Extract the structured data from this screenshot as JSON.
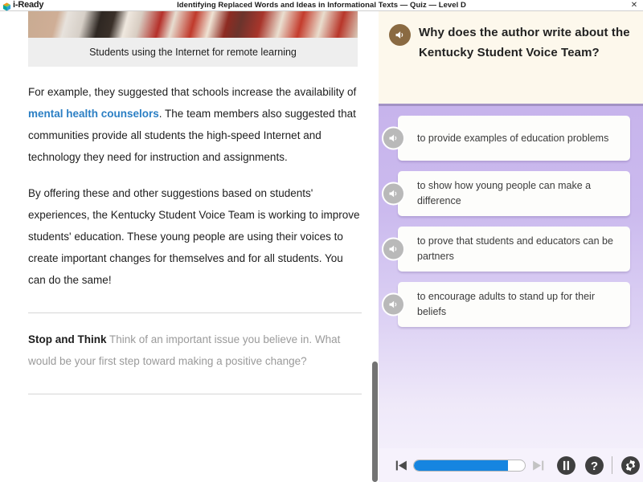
{
  "topbar": {
    "brand": "i-Ready",
    "brand_icon": "cube-logo-icon",
    "title": "Identifying Replaced Words and Ideas in Informational Texts — Quiz — Level D",
    "close_label": "✕"
  },
  "article": {
    "figure": {
      "image_alt": "Students seated on a patterned rug using laptops at home",
      "caption": "Students using the Internet for remote learning"
    },
    "paragraph1": {
      "before_link": "For example, they suggested that schools increase the availability of ",
      "link": "mental health counselors",
      "after_link": ". The team members also suggested that communities provide all students the high-speed Internet and technology they need for instruction and assignments."
    },
    "paragraph2": "By offering these and other suggestions based on students' experiences, the Kentucky Student Voice Team is working to improve students' education. These young people are using their voices to create important changes for themselves and for all students. You can do the same!",
    "stop_and_think": {
      "label": "Stop and Think",
      "prompt": "Think of an important issue you believe in. What would be your first step toward making a positive change?"
    }
  },
  "question": {
    "speaker_icon": "speaker-icon",
    "text": "Why does the author write about the Kentucky Student Voice Team?",
    "choices": [
      {
        "id": "a",
        "text": "to provide examples of education problems",
        "speaker_icon": "speaker-icon"
      },
      {
        "id": "b",
        "text": "to show how young people can make a difference",
        "speaker_icon": "speaker-icon"
      },
      {
        "id": "c",
        "text": "to prove that students and educators can be partners",
        "speaker_icon": "speaker-icon"
      },
      {
        "id": "d",
        "text": "to encourage adults to stand up for their beliefs",
        "speaker_icon": "speaker-icon"
      }
    ]
  },
  "toolbar": {
    "prev_label": "previous-icon",
    "next_label": "next-icon",
    "pause_label": "pause-icon",
    "help_label": "help-icon",
    "settings_label": "settings-icon",
    "progress_percent": 85
  },
  "colors": {
    "question_header_bg": "#fdf8ec",
    "choices_bg_top": "#c7b4ec",
    "choices_bg_bottom": "#f6f2fc",
    "link_blue": "#2b7fc4",
    "progress_blue": "#1685e0",
    "speaker_brown": "#8a6a42",
    "speaker_gray": "#b9b9b9",
    "separator_purple": "#a393c4"
  }
}
